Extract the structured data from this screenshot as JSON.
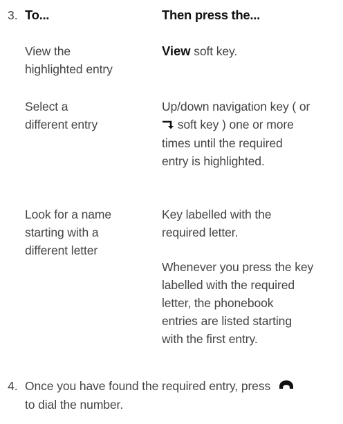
{
  "step3": {
    "number": "3.",
    "header_left": "To...",
    "header_right": "Then press the..."
  },
  "rows": [
    {
      "action_line1": "View the",
      "action_line2": "highlighted entry",
      "key_bold": "View",
      "key_rest": " soft key."
    },
    {
      "action_line1": "Select a",
      "action_line2": "different entry",
      "key_line1": "Up/down navigation key ( or",
      "key_line2_rest": " soft key ) one or more",
      "key_line3": "times until the required",
      "key_line4": "entry is highlighted."
    },
    {
      "action_line1": "Look for a name",
      "action_line2": "starting with a",
      "action_line3": "different letter",
      "key_line1": "Key labelled with the",
      "key_line2": "required letter."
    }
  ],
  "note": {
    "line1": "Whenever you press the key",
    "line2": "labelled with the required",
    "line3": "letter, the phonebook",
    "line4": "entries are listed starting",
    "line5": "with the first entry."
  },
  "step4": {
    "number": "4.",
    "line1": "Once you have found the required entry, press",
    "line2": "to dial the number."
  },
  "icons": {
    "return_key": "return-arrow-icon",
    "handset": "phone-handset-icon"
  }
}
